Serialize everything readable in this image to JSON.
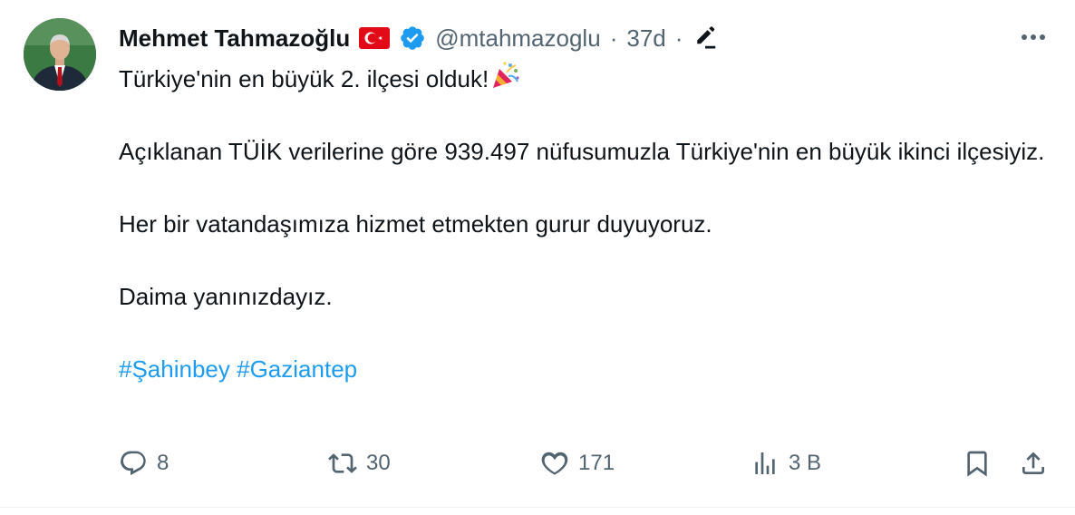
{
  "author": {
    "display_name": "Mehmet Tahmazoğlu",
    "handle": "@mtahmazoglu",
    "separator": "·",
    "time": "37d",
    "separator2": "·"
  },
  "icons": {
    "flag": "turkey-flag-icon",
    "verified": "verified-badge-icon",
    "edit": "edited-pencil-icon",
    "more": "more-options-icon",
    "party": "party-popper-icon",
    "reply": "reply-icon",
    "retweet": "retweet-icon",
    "like": "like-icon",
    "views": "views-icon",
    "bookmark": "bookmark-icon",
    "share": "share-icon"
  },
  "tweet": {
    "line1": "Türkiye'nin en büyük 2. ilçesi olduk!",
    "line2": "Açıklanan TÜİK verilerine göre 939.497 nüfusumuzla Türkiye'nin en büyük ikinci ilçesiyiz.",
    "line3": "Her bir vatandaşımıza hizmet etmekten gurur duyuyoruz.",
    "line4": "Daima yanınızdayız.",
    "hashtags": [
      "#Şahinbey",
      "#Gaziantep"
    ]
  },
  "actions": {
    "replies": "8",
    "retweets": "30",
    "likes": "171",
    "views": "3 B"
  },
  "colors": {
    "text": "#0f1419",
    "secondary": "#536471",
    "link": "#1d9bf0",
    "verified": "#1d9bf0",
    "flag": "#e30a17"
  }
}
